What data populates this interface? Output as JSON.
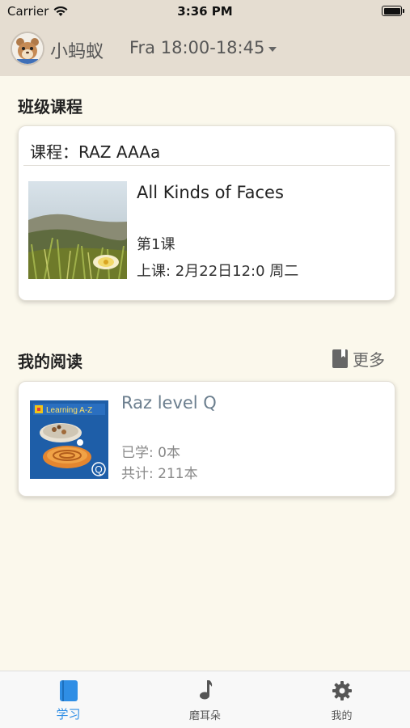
{
  "status_bar": {
    "carrier": "Carrier",
    "time": "3:36 PM",
    "battery_level": 1.0
  },
  "header": {
    "username": "小蚂蚁",
    "class_time": "Fra 18:00-18:45"
  },
  "class_section": {
    "title": "班级课程",
    "course_label": "课程：RAZ AAAa",
    "book_title": "All Kinds of Faces",
    "lesson": "第1课",
    "schedule": "上课: 2月22日12:0 周二"
  },
  "reading_section": {
    "title": "我的阅读",
    "more_label": "更多",
    "book_title": "Raz level Q",
    "learned": "已学: 0本",
    "total": "共计: 211本",
    "cover_brand": "Learning A-Z",
    "cover_level": "Q"
  },
  "tabbar": {
    "tabs": [
      {
        "label": "学习",
        "icon": "book-icon",
        "active": true
      },
      {
        "label": "磨耳朵",
        "icon": "music-note-icon",
        "active": false
      },
      {
        "label": "我的",
        "icon": "gear-icon",
        "active": false
      }
    ]
  },
  "colors": {
    "accent": "#2f8ee5",
    "background": "#fbf8ec",
    "header_bg": "#e5ddd1",
    "reading_title": "#6b7e8e"
  }
}
